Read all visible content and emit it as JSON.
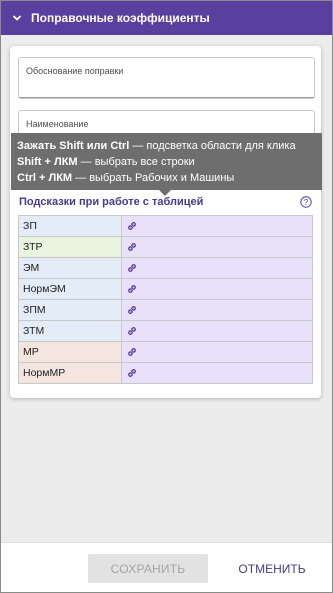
{
  "header": {
    "title": "Поправочные коэффициенты",
    "icon": "chevron-down-icon"
  },
  "form": {
    "field_reason": {
      "label": "Обоснование поправки",
      "value": ""
    },
    "field_name": {
      "label": "Наименование",
      "value": ""
    }
  },
  "tooltip": {
    "lines": [
      {
        "keys": "Зажать Shift или Ctrl",
        "text": " — подсветка области для клика"
      },
      {
        "keys": "Shift + ЛКМ",
        "text": " — выбрать все строки"
      },
      {
        "keys": "Ctrl + ЛКМ",
        "text": " — выбрать Рабочих и Машины"
      }
    ]
  },
  "hints": {
    "title": "Подсказки при работе с таблицей",
    "help_icon": "question-circle-icon"
  },
  "table": {
    "rows": [
      {
        "label": "ЗП",
        "color": "#e4ecf7"
      },
      {
        "label": "ЗТР",
        "color": "#e8f3e0"
      },
      {
        "label": "ЭМ",
        "color": "#e4ecf7"
      },
      {
        "label": "НормЭМ",
        "color": "#e4ecf7"
      },
      {
        "label": "ЗПМ",
        "color": "#e4ecf7"
      },
      {
        "label": "ЗТМ",
        "color": "#e4ecf7"
      },
      {
        "label": "МР",
        "color": "#f5e5df"
      },
      {
        "label": "НормМР",
        "color": "#f5e5df"
      }
    ],
    "link_icon": "link-icon",
    "link_color": "#5b3f9e",
    "link_cell_color": "#e9e1f9"
  },
  "footer": {
    "save_label": "СОХРАНИТЬ",
    "cancel_label": "ОТМЕНИТЬ"
  },
  "colors": {
    "accent": "#5b3f9e",
    "tooltip_bg": "#6e6e6e"
  }
}
